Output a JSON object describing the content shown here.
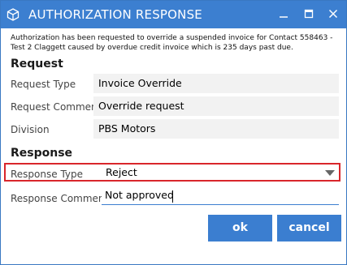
{
  "window": {
    "title": "AUTHORIZATION RESPONSE",
    "icon": "cube-icon",
    "controls": [
      "minimize-icon",
      "maximize-icon",
      "close-icon"
    ]
  },
  "message": "Authorization has been requested to override a suspended invoice for Contact 558463 - Test 2 Claggett caused by overdue credit invoice which is 235 days past due.",
  "request": {
    "heading": "Request",
    "type_label": "Request Type",
    "type_value": "Invoice Override",
    "comment_label": "Request Comment",
    "comment_value": "Override request",
    "division_label": "Division",
    "division_value": "PBS Motors"
  },
  "response": {
    "heading": "Response",
    "type_label": "Response Type",
    "type_value": "Reject",
    "comment_label": "Response Comment",
    "comment_value": "Not approved"
  },
  "buttons": {
    "ok": "ok",
    "cancel": "cancel"
  },
  "colors": {
    "accent": "#3c7fd0",
    "highlight_border": "#d9262b",
    "field_background": "#f2f2f2"
  }
}
